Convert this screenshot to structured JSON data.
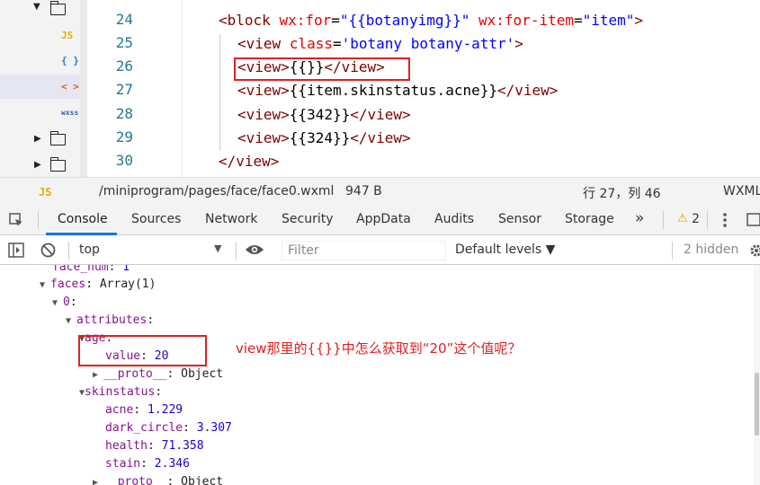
{
  "file_tree": {
    "items": [
      {
        "type": "folder-open",
        "icon": "folder-open-icon"
      },
      {
        "type": "file",
        "icon_label": "JS",
        "icon": "js-file-icon"
      },
      {
        "type": "file",
        "icon_label": "{ }",
        "icon": "json-file-icon"
      },
      {
        "type": "file",
        "icon_label": "< >",
        "icon": "wxml-file-icon",
        "selected": true
      },
      {
        "type": "file",
        "icon_label": "wxss",
        "icon": "wxss-file-icon"
      },
      {
        "type": "folder",
        "icon": "folder-icon"
      },
      {
        "type": "folder",
        "icon": "folder-icon"
      }
    ]
  },
  "editor": {
    "line_numbers": [
      "24",
      "25",
      "26",
      "27",
      "28",
      "29",
      "30"
    ],
    "code": {
      "l24": {
        "open": "<block",
        "attr1": "wx:for",
        "eq1": "=",
        "val1": "\"{{botanyimg}}\"",
        "attr2": "wx:for-item",
        "eq2": "=",
        "val2": "\"item\"",
        "close": ">"
      },
      "l25": {
        "open": "<view",
        "attr": "class",
        "eq": "=",
        "val": "'botany botany-attr'",
        "close": ">"
      },
      "l26": {
        "open": "<view>",
        "text": "{{}}",
        "close": "</view>"
      },
      "l27": {
        "open": "<view>",
        "text": "{{item.skinstatus.acne}}",
        "close": "</view>"
      },
      "l28": {
        "open": "<view>",
        "text": "{{342}}",
        "close": "</view>"
      },
      "l29": {
        "open": "<view>",
        "text": "{{324}}",
        "close": "</view>"
      },
      "l30": {
        "close": "</view>"
      }
    }
  },
  "statusbar": {
    "file_icon_label": "JS",
    "path": "/miniprogram/pages/face/face0.wxml",
    "size": "947 B",
    "position": "行 27，列 46",
    "language": "WXML"
  },
  "devtools": {
    "tabs": [
      "Console",
      "Sources",
      "Network",
      "Security",
      "AppData",
      "Audits",
      "Sensor",
      "Storage"
    ],
    "active_tab": "Console",
    "more": "»",
    "warnings_count": "2",
    "warning_icon": "⚠",
    "toolbar": {
      "context": "top",
      "filter_placeholder": "Filter",
      "levels": "Default levels ▼",
      "hidden": "2 hidden"
    }
  },
  "console": {
    "face_num": {
      "key": "face_num",
      "value": "1"
    },
    "faces": {
      "key": "faces",
      "value": "Array(1)"
    },
    "index0": "0",
    "attributes": "attributes",
    "age": "age",
    "value": {
      "key": "value",
      "val": "20"
    },
    "proto": {
      "key": "__proto__",
      "val": "Object"
    },
    "skinstatus": "skinstatus",
    "acne": {
      "key": "acne",
      "val": "1.229"
    },
    "dark_circle": {
      "key": "dark_circle",
      "val": "3.307"
    },
    "health": {
      "key": "health",
      "val": "71.358"
    },
    "stain": {
      "key": "stain",
      "val": "2.346"
    },
    "annotation": "view那里的{{}}中怎么获取到“20”这个值呢？"
  }
}
